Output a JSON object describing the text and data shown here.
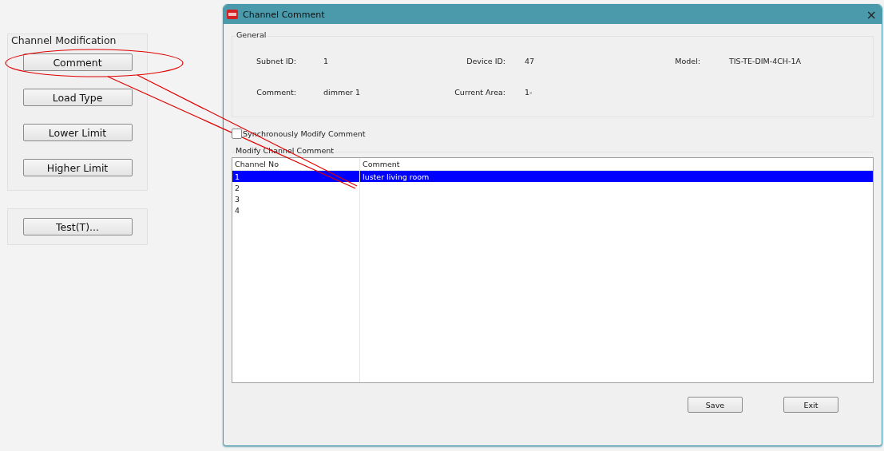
{
  "channel_modification": {
    "title": "Channel Modification",
    "buttons": [
      "Comment",
      "Load Type",
      "Lower Limit",
      "Higher Limit"
    ]
  },
  "test_panel": {
    "buttons": [
      "Test(T)..."
    ]
  },
  "dialog": {
    "title": "Channel Comment",
    "close": "×",
    "general": {
      "title": "General",
      "fields": [
        {
          "label": "Subnet ID:",
          "value": "1"
        },
        {
          "label": "Device ID:",
          "value": "47"
        },
        {
          "label": "Model:",
          "value": "TIS-TE-DIM-4CH-1A"
        },
        {
          "label": "Comment:",
          "value": "dimmer 1"
        },
        {
          "label": "Current Area:",
          "value": "1-"
        }
      ]
    },
    "sync_checkbox": {
      "label": "Synchronously Modify Comment",
      "checked": false
    },
    "modify": {
      "title": "Modify Channel Comment",
      "columns": [
        "Channel No",
        "Comment"
      ],
      "rows": [
        {
          "cells": [
            "1",
            "luster living room"
          ],
          "selected": true
        },
        {
          "cells": [
            "2",
            ""
          ],
          "selected": false
        },
        {
          "cells": [
            "3",
            ""
          ],
          "selected": false
        },
        {
          "cells": [
            "4",
            ""
          ],
          "selected": false
        }
      ]
    },
    "buttons": [
      "Save",
      "Exit"
    ]
  }
}
